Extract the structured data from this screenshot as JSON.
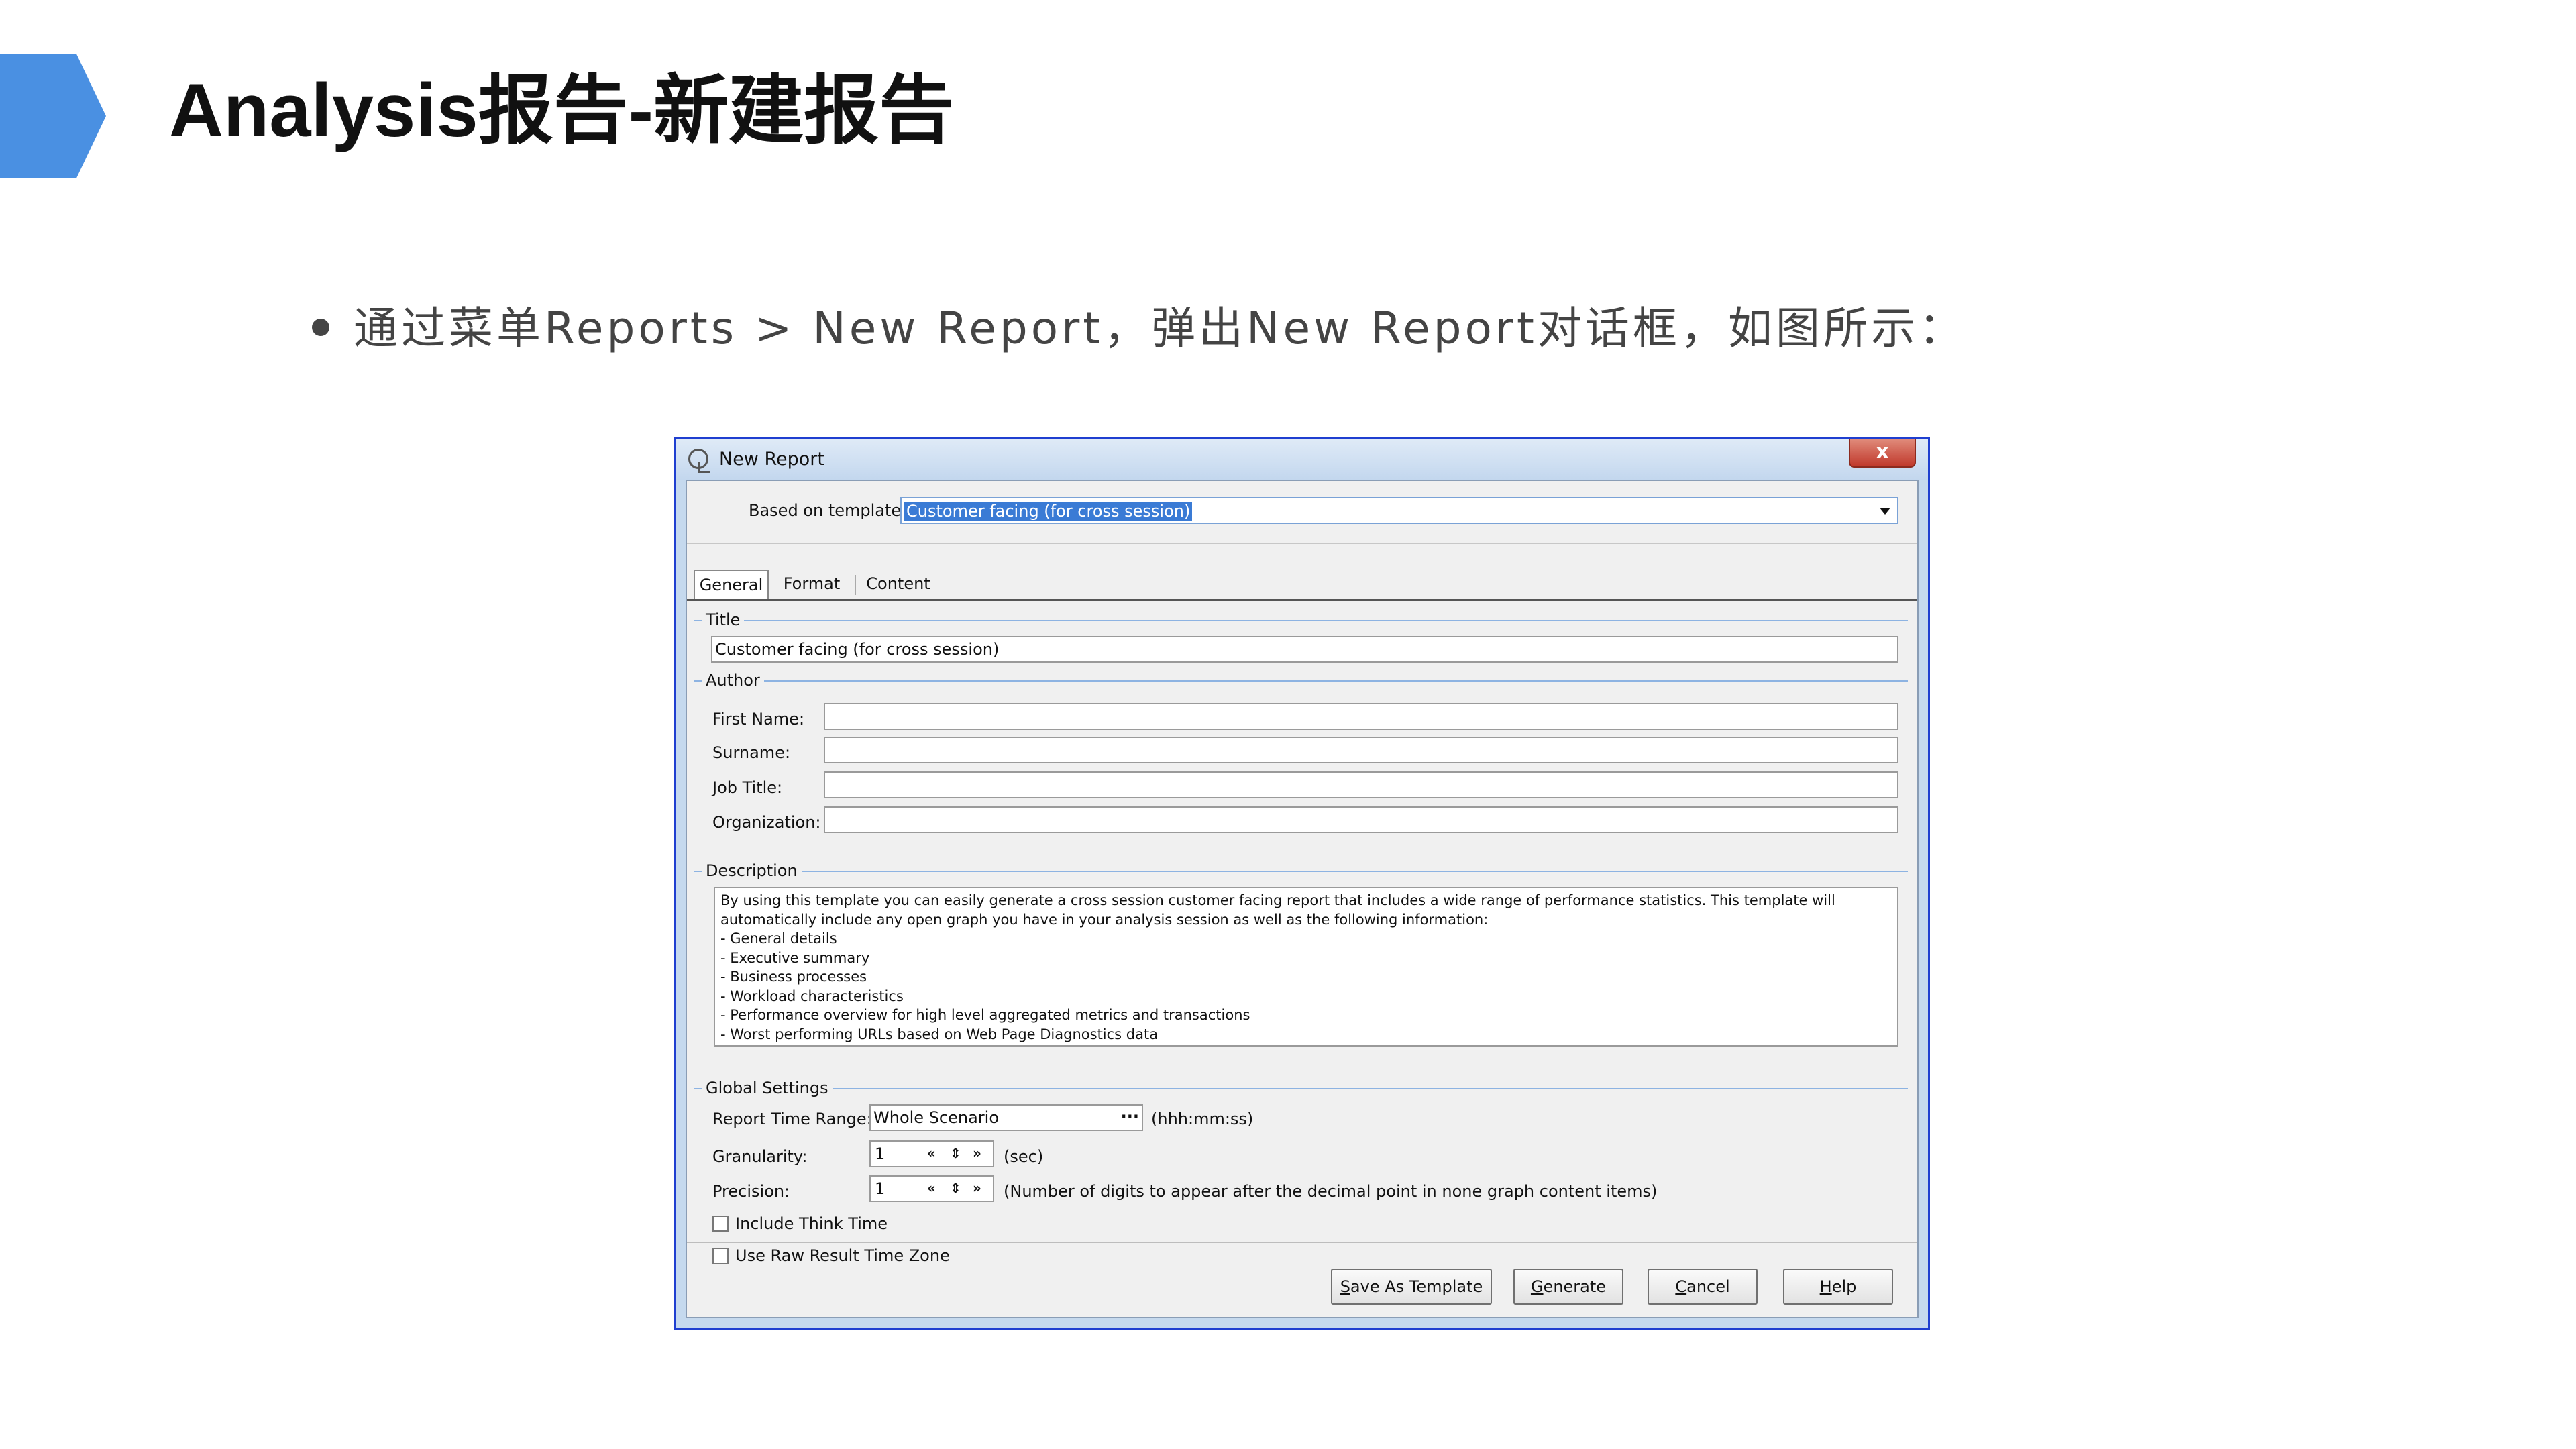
{
  "slide": {
    "title": "Analysis报告-新建报告",
    "bullet": "通过菜单Reports > New Report，弹出New Report对话框，如图所示："
  },
  "dialog": {
    "window_title": "New Report",
    "close_glyph": "x",
    "based_on_template_label": "Based on template",
    "based_on_template_value": "Customer facing (for cross session)",
    "tabs": [
      "General",
      "Format",
      "Content"
    ],
    "title_section": {
      "label": "Title",
      "value": "Customer facing (for cross session)"
    },
    "author_section": {
      "label": "Author",
      "first_name_label": "First Name:",
      "first_name_value": "",
      "surname_label": "Surname:",
      "surname_value": "",
      "job_title_label": "Job Title:",
      "job_title_value": "",
      "organization_label": "Organization:",
      "organization_value": ""
    },
    "description_section": {
      "label": "Description",
      "lines": [
        "By using this template you can easily generate a cross session customer facing report that includes a wide range of performance statistics. This template will",
        "automatically include any open graph you have in your analysis session as well as the following information:",
        "- General details",
        "- Executive summary",
        "- Business processes",
        "- Workload characteristics",
        "- Performance overview for high level aggregated metrics and transactions",
        "- Worst performing URLs based on Web Page Diagnostics data"
      ]
    },
    "global_settings": {
      "label": "Global Settings",
      "report_time_range_label": "Report Time Range:",
      "report_time_range_value": "Whole Scenario",
      "report_time_range_button": "···",
      "report_time_range_note": "(hhh:mm:ss)",
      "granularity_label": "Granularity:",
      "granularity_value": "1",
      "granularity_note": "(sec)",
      "precision_label": "Precision:",
      "precision_value": "1",
      "precision_note": "(Number of digits to appear after the decimal point in none graph content items)",
      "include_think_time_label": "Include Think Time",
      "include_think_time_checked": false,
      "use_raw_result_time_zone_label": "Use Raw Result Time Zone",
      "use_raw_result_time_zone_checked": false
    },
    "buttons": {
      "save_as_template_mnemonic": "S",
      "save_as_template_rest": "ave As Template",
      "generate_mnemonic": "G",
      "generate_rest": "enerate",
      "cancel_mnemonic": "C",
      "cancel_rest": "ancel",
      "help_mnemonic": "H",
      "help_rest": "elp"
    },
    "spinner_glyphs": {
      "first": "«",
      "updown": "⇕",
      "last": "»"
    }
  }
}
